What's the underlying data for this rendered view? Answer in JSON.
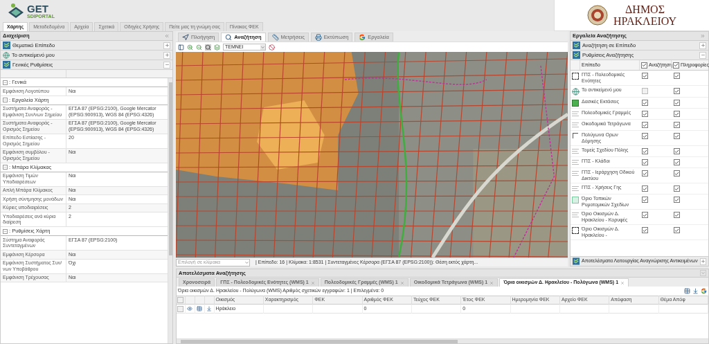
{
  "header": {
    "logo_text": "GET",
    "logo_subtext": "SDIPORTAL",
    "municipality_line1": "ΔΗΜΟΣ",
    "municipality_line2": "ΗΡΑΚΛΕΙΟΥ"
  },
  "main_tabs": [
    {
      "label": "Χάρτης",
      "selected": true
    },
    {
      "label": "Μεταδεδομένα",
      "selected": false
    },
    {
      "label": "Αρχεία",
      "selected": false
    },
    {
      "label": "Σχετικά",
      "selected": false
    },
    {
      "label": "Οδηγίες Χρήσης",
      "selected": false
    },
    {
      "label": "Πείτε μας τη γνώμη σας",
      "selected": false
    },
    {
      "label": "Πίνακας ΦΕΚ",
      "selected": false
    }
  ],
  "left_panel": {
    "title": "Διαχείριση",
    "sections": [
      {
        "label": "Θεματικό Επίπεδο",
        "expanded": false
      },
      {
        "label": "Το αντικείμενό μου",
        "expanded": false
      },
      {
        "label": "Γενικές Ρυθμίσεις",
        "expanded": true
      }
    ],
    "groups": [
      {
        "title": ": Γενικά",
        "rows": [
          {
            "label": "Εμφάνιση Λογοτύπου",
            "value": "Ναι"
          }
        ]
      },
      {
        "title": ": Εργαλεία Χάρτη",
        "rows": [
          {
            "label": "Συστήματα Αναφοράς - Εμφάνιση Συν/νων Σημείου",
            "value": "ΕΓΣΑ 87 (EPSG:2100), Google Mercator (EPSG:900913), WGS 84 (EPSG:4326)"
          },
          {
            "label": "Συστήματα Αναφοράς - Ορισμός Σημείου",
            "value": "ΕΓΣΑ 87 (EPSG:2100), Google Mercator (EPSG:900913), WGS 84 (EPSG:4326)"
          },
          {
            "label": "Επίπεδο Εστίασης - Ορισμός Σημείου",
            "value": "20"
          },
          {
            "label": "Εμφάνιση συμβόλου - Ορισμός Σημείου",
            "value": "Ναι"
          }
        ]
      },
      {
        "title": ": Μπάρα Κλίμακας",
        "rows": [
          {
            "label": "Εμφάνιση Τιμών Υποδιαιρέσεων",
            "value": "Ναι"
          },
          {
            "label": "Απλή Μπάρα Κλίμακος",
            "value": "Ναι"
          },
          {
            "label": "Χρήση σύντμησης μονάδων",
            "value": "Ναι"
          },
          {
            "label": "Κύριες υποδιαιρέσεις",
            "value": "2"
          },
          {
            "label": "Υποδιαιρέσεις ανά κύρια διαίρεση",
            "value": "2"
          }
        ]
      },
      {
        "title": ": Ρυθμίσεις Χάρτη",
        "rows": [
          {
            "label": "Σύστημα Αναφοράς Συντεταγμένων",
            "value": "ΕΓΣΑ 87 (EPSG:2100)"
          },
          {
            "label": "Εμφάνιση Κέρσορα",
            "value": "Ναι"
          },
          {
            "label": "Εμφάνιση Συστήματος Συν/νων Υποβάθρου",
            "value": "Όχι"
          },
          {
            "label": "Εμφάνιση Τρέχουσας",
            "value": "Ναι"
          }
        ]
      }
    ]
  },
  "map": {
    "tabs": [
      {
        "label": "Πλοήγηση",
        "selected": false
      },
      {
        "label": "Αναζήτηση",
        "selected": true
      },
      {
        "label": "Μετρήσεις",
        "selected": false
      },
      {
        "label": "Εκτύπωση",
        "selected": false
      },
      {
        "label": "Εργαλεία",
        "selected": false
      }
    ],
    "operator": "ΤΕΜΝΕΙ",
    "scale_placeholder": "Επιλογή σε κλίμακα",
    "status": "| Επίπεδο: 16 | Κλίμακα: 1:8531 | Συντεταγμένες Κέρσορα (ΕΓΣΑ 87 (EPSG:2100)): Θέση εκτός χάρτη..."
  },
  "search_tools": {
    "title": "Εργαλεία Αναζήτησης",
    "sections": [
      {
        "label": "Αναζήτηση σε Επίπεδο",
        "expanded": false
      },
      {
        "label": "Ρυθμίσεις Αναζήτησης",
        "expanded": true
      }
    ],
    "columns": {
      "layer": "Επίπεδο",
      "search": "Αναζήτηση",
      "info": "Πληροφορίες",
      "search_all": true,
      "info_all": true
    },
    "layers": [
      {
        "name": "ΓΠΣ - Πολεοδομικές Ενότητες",
        "kind": "dashed",
        "search": true,
        "info": true
      },
      {
        "name": "Το αντικείμενό μου",
        "kind": "globe",
        "search": false,
        "info": true
      },
      {
        "name": "Δασικές Εκτάσεις",
        "kind": "green",
        "search": true,
        "info": true
      },
      {
        "name": "Πολεοδομικές Γραμμές",
        "kind": "lines",
        "search": true,
        "info": true
      },
      {
        "name": "Οικοδομικά Τετράγωνα",
        "kind": "lines",
        "search": true,
        "info": true
      },
      {
        "name": "Πολύγωνα Ορων Δόμησης",
        "kind": "corner",
        "search": true,
        "info": true
      },
      {
        "name": "Τομείς Σχεδίου Πόλης",
        "kind": "lines",
        "search": true,
        "info": true
      },
      {
        "name": "ΓΠΣ - Κλάδοι",
        "kind": "lines",
        "search": true,
        "info": true
      },
      {
        "name": "ΓΠΣ - Ιεράρχηση Οδικού Δικτύου",
        "kind": "lines",
        "search": true,
        "info": true
      },
      {
        "name": "ΓΠΣ - Χρήσεις Γης",
        "kind": "lines",
        "search": true,
        "info": true
      },
      {
        "name": "Όριο Τοπικών Ρυμοτομικών Σχεδίων",
        "kind": "light",
        "search": true,
        "info": true
      },
      {
        "name": "Όριο Οικισμών Δ. Ηρακλείου - Κορυφές",
        "kind": "lines",
        "search": true,
        "info": true
      },
      {
        "name": "Όριο Οικισμών Δ. Ηρακλείου -",
        "kind": "dashed",
        "search": true,
        "info": true
      }
    ],
    "footer": {
      "label": "Αποτελέσματα Λειτουργίας Αναγνώρισης Αντικειμένων",
      "expanded": false
    }
  },
  "results": {
    "title": "Αποτελέσματα Αναζήτησης",
    "tabs": [
      {
        "label": "Χρονοσειρά",
        "closable": false,
        "selected": false
      },
      {
        "label": "ΓΠΣ - Πολεοδομικές Ενότητες (WMS) 1",
        "closable": true,
        "selected": false
      },
      {
        "label": "Πολεοδομικές Γραμμές (WMS) 1",
        "closable": true,
        "selected": false
      },
      {
        "label": "Οικοδομικά Τετράγωνα (WMS) 1",
        "closable": true,
        "selected": false
      },
      {
        "label": "Όρια οικισμών Δ. Ηρακλείου - Πολύγωνα (WMS) 1",
        "closable": true,
        "selected": true
      }
    ],
    "summary": "Όρια οικισμών Δ. Ηρακλείου - Πολύγωνα (WMS) Αριθμός σχετικών εγγραφών: 1 | Επιλεγμένα: 0",
    "select_all": false,
    "columns": [
      "Οικισμός",
      "Χαρακτηρισμός",
      "ΦΕΚ",
      "Αριθμός ΦΕΚ",
      "Τεύχος ΦΕΚ",
      "Έτος ΦΕΚ",
      "Ημερομηνία ΦΕΚ",
      "Αρχείο ΦΕΚ",
      "Απόφαση",
      "Θέμα Απόφ"
    ],
    "rows": [
      {
        "checked": false,
        "cells": [
          "Ηράκλειο",
          "",
          "",
          "0",
          "",
          "0",
          "",
          "",
          "",
          ""
        ]
      }
    ]
  }
}
